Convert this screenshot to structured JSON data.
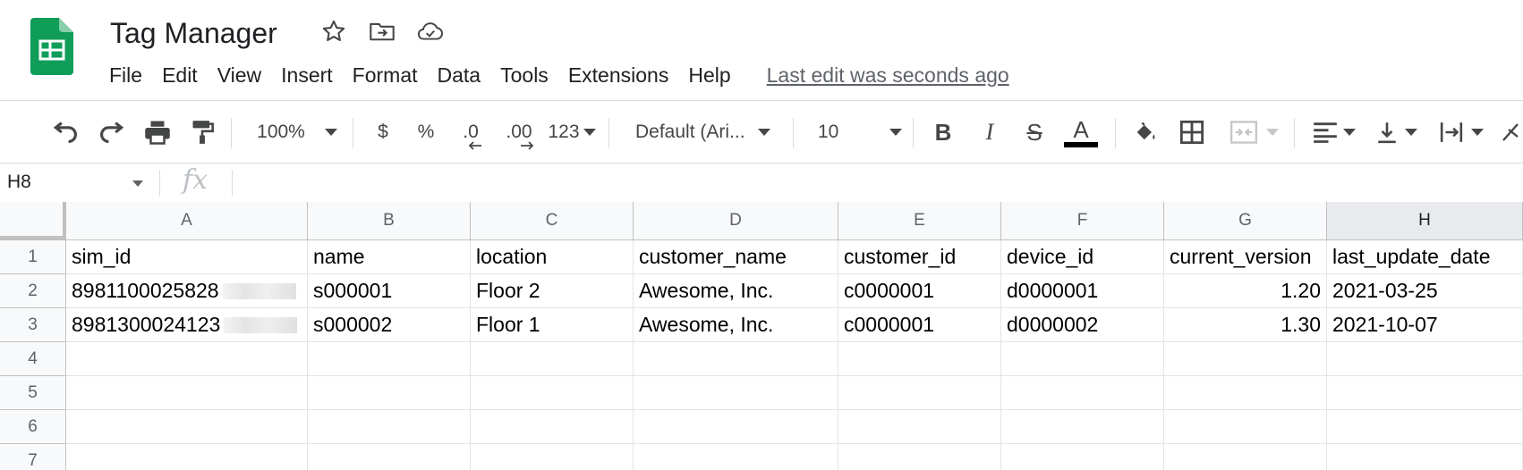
{
  "app": {
    "title": "Tag Manager",
    "logo_icon": "sheets-logo-icon",
    "title_icons": [
      "star-icon",
      "move-to-folder-icon",
      "cloud-saved-icon"
    ]
  },
  "menu": {
    "items": [
      "File",
      "Edit",
      "View",
      "Insert",
      "Format",
      "Data",
      "Tools",
      "Extensions",
      "Help"
    ],
    "last_edit": "Last edit was seconds ago"
  },
  "toolbar": {
    "zoom": "100%",
    "currency": "$",
    "percent": "%",
    "decrease_decimal": ".0",
    "increase_decimal": ".00",
    "more_formats": "123",
    "font": "Default (Ari...",
    "font_size": "10",
    "bold": "B",
    "italic": "I",
    "strikethrough": "S",
    "text_color": "A",
    "text_color_value": "#000000"
  },
  "formula_bar": {
    "name_box": "H8",
    "fx_label": "fx",
    "formula": ""
  },
  "grid": {
    "columns": [
      "A",
      "B",
      "C",
      "D",
      "E",
      "F",
      "G",
      "H"
    ],
    "selected_column": "H",
    "rows": [
      "1",
      "2",
      "3",
      "4",
      "5",
      "6",
      "7"
    ],
    "cells": [
      [
        "sim_id",
        "name",
        "location",
        "customer_name",
        "customer_id",
        "device_id",
        "current_version",
        "last_update_date"
      ],
      [
        "8981100025828",
        "s000001",
        "Floor 2",
        "Awesome, Inc.",
        "c0000001",
        "d0000001",
        "1.20",
        "2021-03-25"
      ],
      [
        "8981300024123",
        "s000002",
        "Floor 1",
        "Awesome, Inc.",
        "c0000001",
        "d0000002",
        "1.30",
        "2021-10-07"
      ],
      [
        "",
        "",
        "",
        "",
        "",
        "",
        "",
        ""
      ],
      [
        "",
        "",
        "",
        "",
        "",
        "",
        "",
        ""
      ],
      [
        "",
        "",
        "",
        "",
        "",
        "",
        "",
        ""
      ],
      [
        "",
        "",
        "",
        "",
        "",
        "",
        "",
        ""
      ]
    ]
  },
  "colors": {
    "brand_green": "#0f9d58",
    "header_bg": "#f8f9fa",
    "selected_header_bg": "#e8eaed"
  }
}
